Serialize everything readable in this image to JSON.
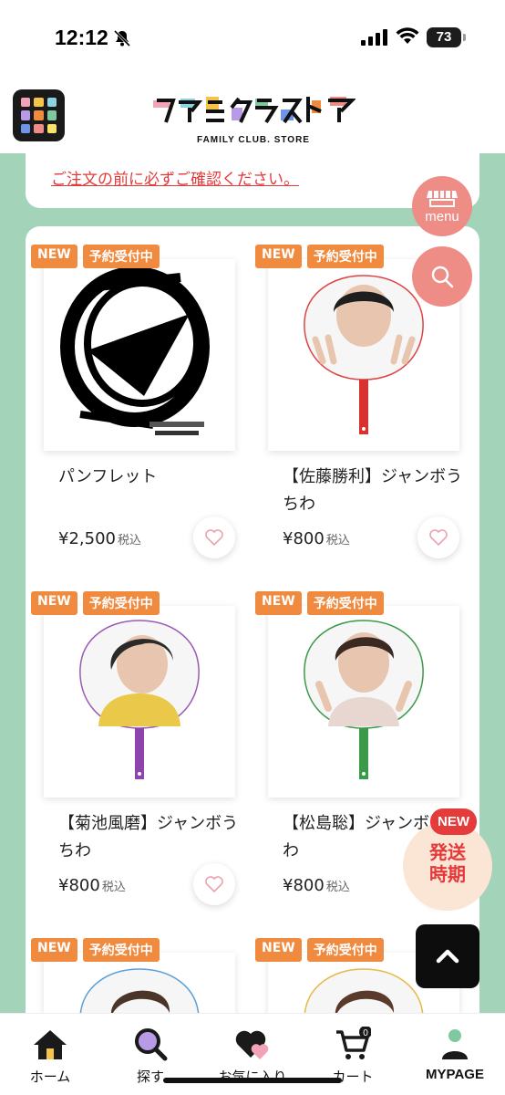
{
  "status": {
    "time": "12:12",
    "battery": "73"
  },
  "header": {
    "logo_text": "ファミクラストア",
    "logo_sub": "FAMILY CLUB. STORE"
  },
  "notice": {
    "link": "ご注文の前に必ずご確認ください。"
  },
  "fabs": {
    "menu_label": "menu"
  },
  "products": [
    {
      "badge_new": "NEW",
      "badge_status": "予約受付中",
      "name": "パンフレット",
      "price": "¥2,500",
      "tax": "税込",
      "image": "pamphlet-cover"
    },
    {
      "badge_new": "NEW",
      "badge_status": "予約受付中",
      "name": "【佐藤勝利】ジャンボうちわ",
      "price": "¥800",
      "tax": "税込",
      "image": "uchiwa-red"
    },
    {
      "badge_new": "NEW",
      "badge_status": "予約受付中",
      "name": "【菊池風磨】ジャンボうちわ",
      "price": "¥800",
      "tax": "税込",
      "image": "uchiwa-purple"
    },
    {
      "badge_new": "NEW",
      "badge_status": "予約受付中",
      "name": "【松島聡】ジャンボうちわ",
      "price": "¥800",
      "tax": "税込",
      "image": "uchiwa-green"
    },
    {
      "badge_new": "NEW",
      "badge_status": "予約受付中"
    },
    {
      "badge_new": "NEW",
      "badge_status": "予約受付中"
    }
  ],
  "shipping": {
    "new": "NEW",
    "label_1": "発送",
    "label_2": "時期"
  },
  "nav": {
    "home": "ホーム",
    "search": "探す",
    "favorites": "お気に入り",
    "cart": "カート",
    "cart_count": "0",
    "mypage": "MYPAGE"
  },
  "colors": {
    "bg_green": "#a3d4b9",
    "accent_orange": "#f08a3f",
    "fab_pink": "#ee8c86",
    "notice_red": "#e23a3a"
  }
}
